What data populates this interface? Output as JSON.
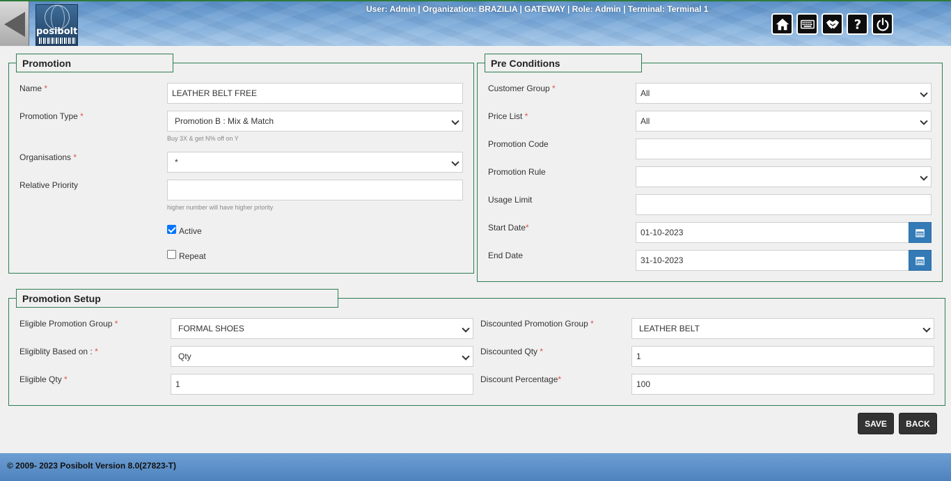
{
  "header": {
    "user_info": "User: Admin | Organization: BRAZILIA | GATEWAY | Role: Admin | Terminal: Terminal 1",
    "logo_text": "posibolt",
    "icons": [
      "home-icon",
      "keyboard-icon",
      "handshake-icon",
      "help-icon",
      "power-icon"
    ]
  },
  "promotion": {
    "legend": "Promotion",
    "name_label": "Name",
    "name_value": "LEATHER BELT FREE",
    "type_label": "Promotion Type",
    "type_value": "Promotion B : Mix & Match",
    "type_hint": "Buy 3X & get N% off on Y",
    "org_label": "Organisations",
    "org_value": "*",
    "priority_label": "Relative Priority",
    "priority_value": "",
    "priority_hint": "higher number will have higher priority",
    "active_label": "Active",
    "active_checked": true,
    "repeat_label": "Repeat",
    "repeat_checked": false
  },
  "preconditions": {
    "legend": "Pre Conditions",
    "customer_group_label": "Customer Group",
    "customer_group_value": "All",
    "price_list_label": "Price List",
    "price_list_value": "All",
    "promo_code_label": "Promotion Code",
    "promo_code_value": "",
    "promo_rule_label": "Promotion Rule",
    "promo_rule_value": "",
    "usage_limit_label": "Usage Limit",
    "usage_limit_value": "",
    "start_date_label": "Start Date",
    "start_date_value": "01-10-2023",
    "end_date_label": "End Date",
    "end_date_value": "31-10-2023"
  },
  "setup": {
    "legend": "Promotion Setup",
    "eligible_group_label": "Eligible Promotion Group",
    "eligible_group_value": "FORMAL SHOES",
    "eligibility_based_label": "Eligiblity Based on :",
    "eligibility_based_value": "Qty",
    "eligible_qty_label": "Eligible Qty",
    "eligible_qty_value": "1",
    "discounted_group_label": "Discounted Promotion Group",
    "discounted_group_value": "LEATHER BELT",
    "discounted_qty_label": "Discounted Qty",
    "discounted_qty_value": "1",
    "discount_pct_label": "Discount Percentage",
    "discount_pct_value": "100"
  },
  "actions": {
    "save_label": "SAVE",
    "back_label": "BACK"
  },
  "footer": {
    "text": "© 2009- 2023 Posibolt Version  8.0(27823-T)"
  },
  "colors": {
    "border_green": "#2e7d52",
    "calendar_blue": "#337ab7",
    "required_red": "#d9534f"
  }
}
